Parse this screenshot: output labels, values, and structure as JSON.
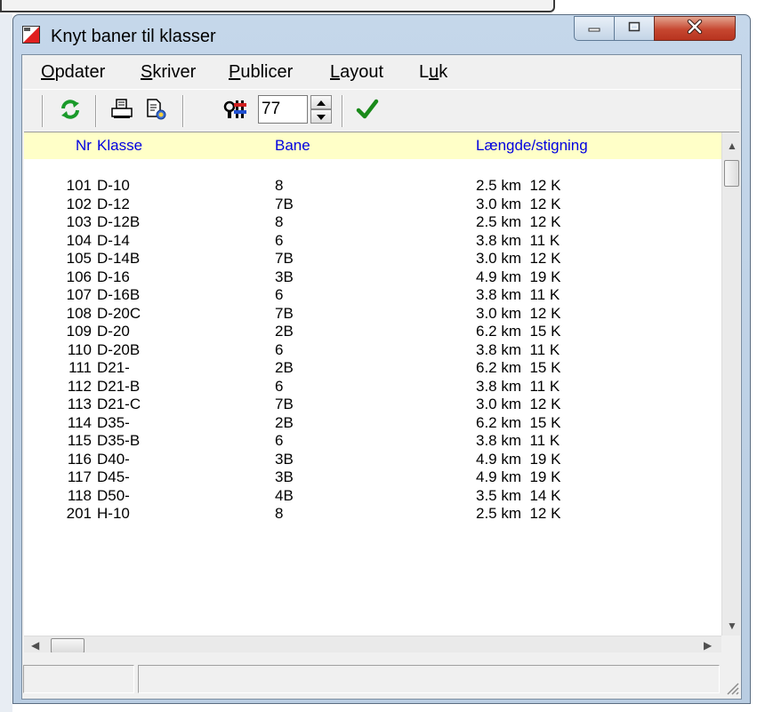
{
  "window": {
    "title": "Knyt baner til klasser",
    "caption_buttons": [
      "minimize-icon",
      "maximize-icon",
      "close-icon"
    ]
  },
  "menu": {
    "items": [
      {
        "label": "Opdater",
        "accel": "O"
      },
      {
        "label": "Skriver",
        "accel": "S"
      },
      {
        "label": "Publicer",
        "accel": "P"
      },
      {
        "label": "Layout",
        "accel": "L"
      },
      {
        "label": "Luk",
        "accel": "u"
      }
    ]
  },
  "toolbar": {
    "icons": [
      "refresh-icon",
      "print-icon",
      "print-preview-icon",
      "settings-icon",
      "spin-up-icon",
      "spin-down-icon",
      "checkmark-icon"
    ],
    "spin_value": "77"
  },
  "list": {
    "headers": {
      "nr": "Nr",
      "klasse": "Klasse",
      "bane": "Bane",
      "laengde": "Længde/stigning"
    },
    "rows": [
      {
        "nr": "101",
        "klasse": "D-10",
        "bane": "8",
        "laengde": "2.5 km  12 K"
      },
      {
        "nr": "102",
        "klasse": "D-12",
        "bane": "7B",
        "laengde": "3.0 km  12 K"
      },
      {
        "nr": "103",
        "klasse": "D-12B",
        "bane": "8",
        "laengde": "2.5 km  12 K"
      },
      {
        "nr": "104",
        "klasse": "D-14",
        "bane": "6",
        "laengde": "3.8 km  11 K"
      },
      {
        "nr": "105",
        "klasse": "D-14B",
        "bane": "7B",
        "laengde": "3.0 km  12 K"
      },
      {
        "nr": "106",
        "klasse": "D-16",
        "bane": "3B",
        "laengde": "4.9 km  19 K"
      },
      {
        "nr": "107",
        "klasse": "D-16B",
        "bane": "6",
        "laengde": "3.8 km  11 K"
      },
      {
        "nr": "108",
        "klasse": "D-20C",
        "bane": "7B",
        "laengde": "3.0 km  12 K"
      },
      {
        "nr": "109",
        "klasse": "D-20",
        "bane": "2B",
        "laengde": "6.2 km  15 K"
      },
      {
        "nr": "110",
        "klasse": "D-20B",
        "bane": "6",
        "laengde": "3.8 km  11 K"
      },
      {
        "nr": "111",
        "klasse": "D21-",
        "bane": "2B",
        "laengde": "6.2 km  15 K"
      },
      {
        "nr": "112",
        "klasse": "D21-B",
        "bane": "6",
        "laengde": "3.8 km  11 K"
      },
      {
        "nr": "113",
        "klasse": "D21-C",
        "bane": "7B",
        "laengde": "3.0 km  12 K"
      },
      {
        "nr": "114",
        "klasse": "D35-",
        "bane": "2B",
        "laengde": "6.2 km  15 K"
      },
      {
        "nr": "115",
        "klasse": "D35-B",
        "bane": "6",
        "laengde": "3.8 km  11 K"
      },
      {
        "nr": "116",
        "klasse": "D40-",
        "bane": "3B",
        "laengde": "4.9 km  19 K"
      },
      {
        "nr": "117",
        "klasse": "D45-",
        "bane": "3B",
        "laengde": "4.9 km  19 K"
      },
      {
        "nr": "118",
        "klasse": "D50-",
        "bane": "4B",
        "laengde": "3.5 km  14 K"
      },
      {
        "nr": "201",
        "klasse": "H-10",
        "bane": "8",
        "laengde": "2.5 km  12 K"
      }
    ]
  },
  "colors": {
    "header_bg": "#ffffc8",
    "header_text": "#0000e0",
    "titlebar": "#c5d7ea",
    "close_button": "#c64730",
    "refresh_green": "#1a9a2a",
    "check_green": "#1a8a1a"
  }
}
